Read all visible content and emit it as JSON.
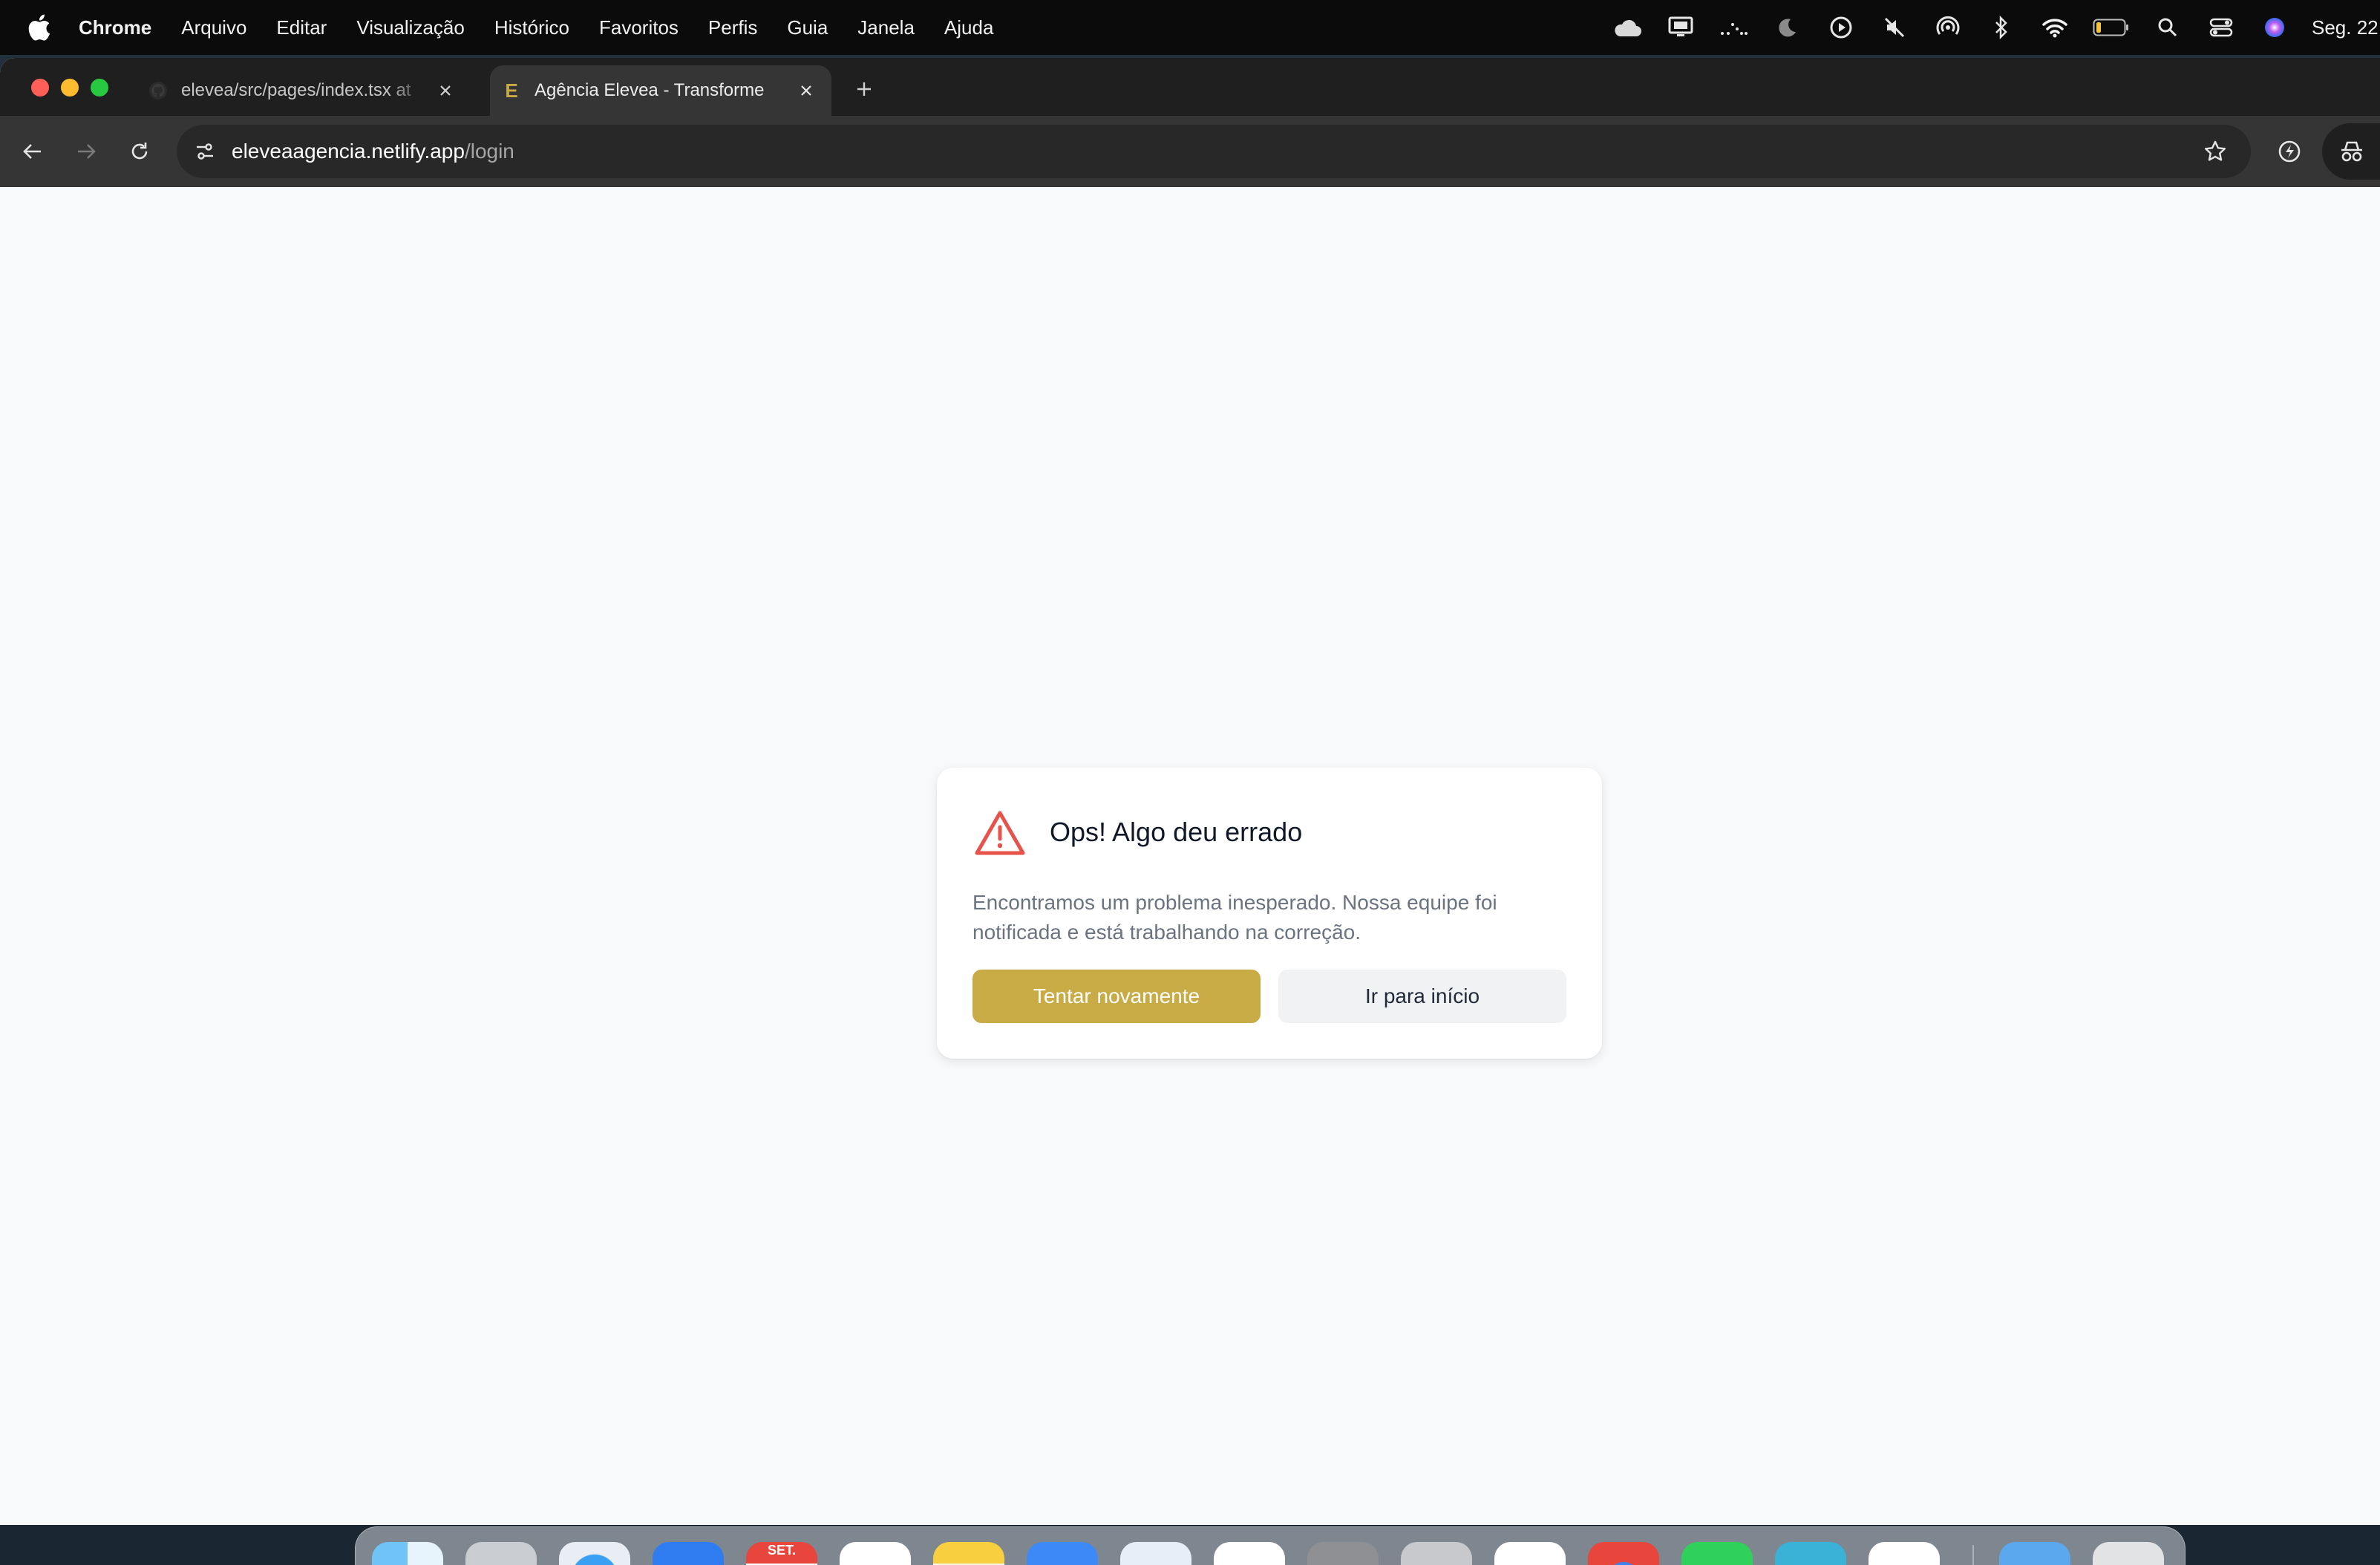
{
  "menubar": {
    "app_name": "Chrome",
    "items": [
      "Arquivo",
      "Editar",
      "Visualização",
      "Histórico",
      "Favoritos",
      "Perfis",
      "Guia",
      "Janela",
      "Ajuda"
    ],
    "status_icons": [
      "cloud-icon",
      "display-icon",
      "activity-icon",
      "moon-icon",
      "play-icon",
      "mute-icon",
      "airdrop-icon",
      "bluetooth-icon",
      "wifi-icon",
      "battery-icon",
      "search-icon",
      "control-center-icon",
      "siri-icon"
    ],
    "clock": "Seg. 22"
  },
  "browser": {
    "tabs": [
      {
        "title": "elevea/src/pages/index.tsx at",
        "icon": "github-icon",
        "active": false
      },
      {
        "title": "Agência Elevea - Transforme",
        "icon": "elevea-favicon",
        "favicon_letter": "E",
        "active": true
      }
    ],
    "url": {
      "host": "eleveaagencia.netlify.app",
      "path": "/login"
    }
  },
  "error_card": {
    "title": "Ops! Algo deu errado",
    "message": "Encontramos um problema inesperado. Nossa equipe foi notificada e está trabalhando na correção.",
    "primary_label": "Tentar novamente",
    "secondary_label": "Ir para início",
    "accent_color": "#c9ab46",
    "warning_color": "#e5534b"
  },
  "dock": {
    "calendar_month": "SET.",
    "apps": [
      "finder",
      "launchpad",
      "safari",
      "mail",
      "calendar",
      "reminders",
      "notes",
      "app-store",
      "preview",
      "numbers",
      "system-settings",
      "iphone-mirroring",
      "capcut",
      "chrome",
      "whatsapp",
      "mail-2",
      "outlook",
      "downloads-folder",
      "trash"
    ]
  }
}
